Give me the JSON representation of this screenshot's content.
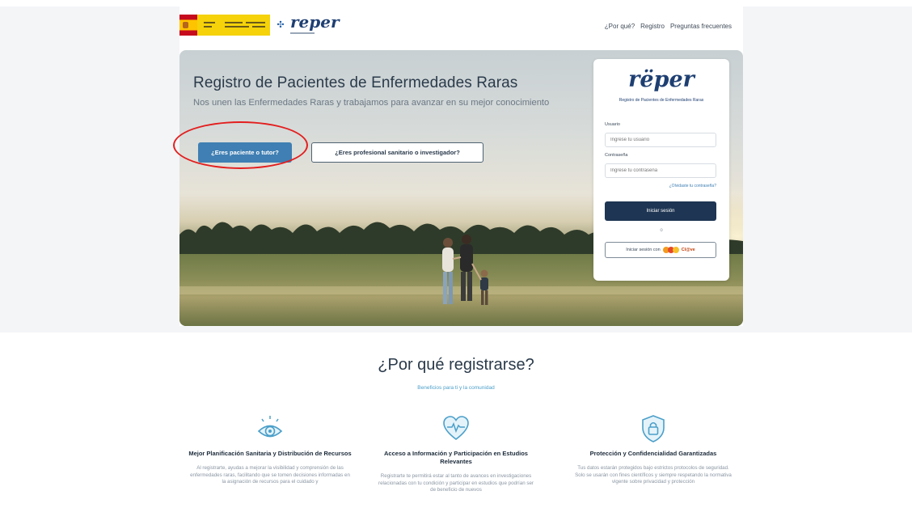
{
  "header": {
    "brand": "reper",
    "nav": [
      {
        "label": "¿Por qué?"
      },
      {
        "label": "Registro"
      },
      {
        "label": "Preguntas frecuentes"
      }
    ]
  },
  "hero": {
    "title": "Registro de Pacientes de Enfermedades Raras",
    "subtitle": "Nos unen las Enfermedades Raras y trabajamos para avanzar en su mejor conocimiento",
    "patient_button": "¿Eres paciente o tutor?",
    "professional_button": "¿Eres profesional sanitario o investigador?"
  },
  "login": {
    "brand": "rëper",
    "brand_sub": "Registro de Pacientes de Enfermedades Raras",
    "user_label": "Usuario",
    "user_placeholder": "Ingrese tu usuario",
    "password_label": "Contraseña",
    "password_placeholder": "Ingrese tu contraseña",
    "forgot": "¿Olvidaste tu contraseña?",
    "login_button": "Iniciar sesión",
    "or": "o",
    "clave_button": "Iniciar sesión con",
    "clave_brand": "Cl@ve"
  },
  "why": {
    "title": "¿Por qué registrarse?",
    "subtitle": "Beneficios para ti y la comunidad",
    "features": [
      {
        "icon": "eye-icon",
        "title": "Mejor Planificación Sanitaria y Distribución de Recursos",
        "text": "Al registrarte, ayudas a mejorar la visibilidad y comprensión de las enfermedades raras, facilitando que se tomen decisiones informadas en la asignación de recursos para el cuidado y"
      },
      {
        "icon": "heartbeat-icon",
        "title": "Acceso a Información y Participación en Estudios Relevantes",
        "text": "Registrarte te permitirá estar al tanto de avances en investigaciones relacionadas con tu condición y participar en estudios que podrían ser de beneficio de nuevos"
      },
      {
        "icon": "lock-icon",
        "title": "Protección y Confidencialidad Garantizadas",
        "text": "Tus datos estarán protegidos bajo estrictos protocolos de seguridad. Solo se usarán con fines científicos y siempre respetando la normativa vigente sobre privacidad y protección"
      }
    ]
  },
  "colors": {
    "primary_button": "#3f7fb3",
    "dark_button": "#1e3553",
    "brand": "#1e3f72",
    "accent": "#4b9fc9",
    "annotation": "#e31e1e"
  }
}
